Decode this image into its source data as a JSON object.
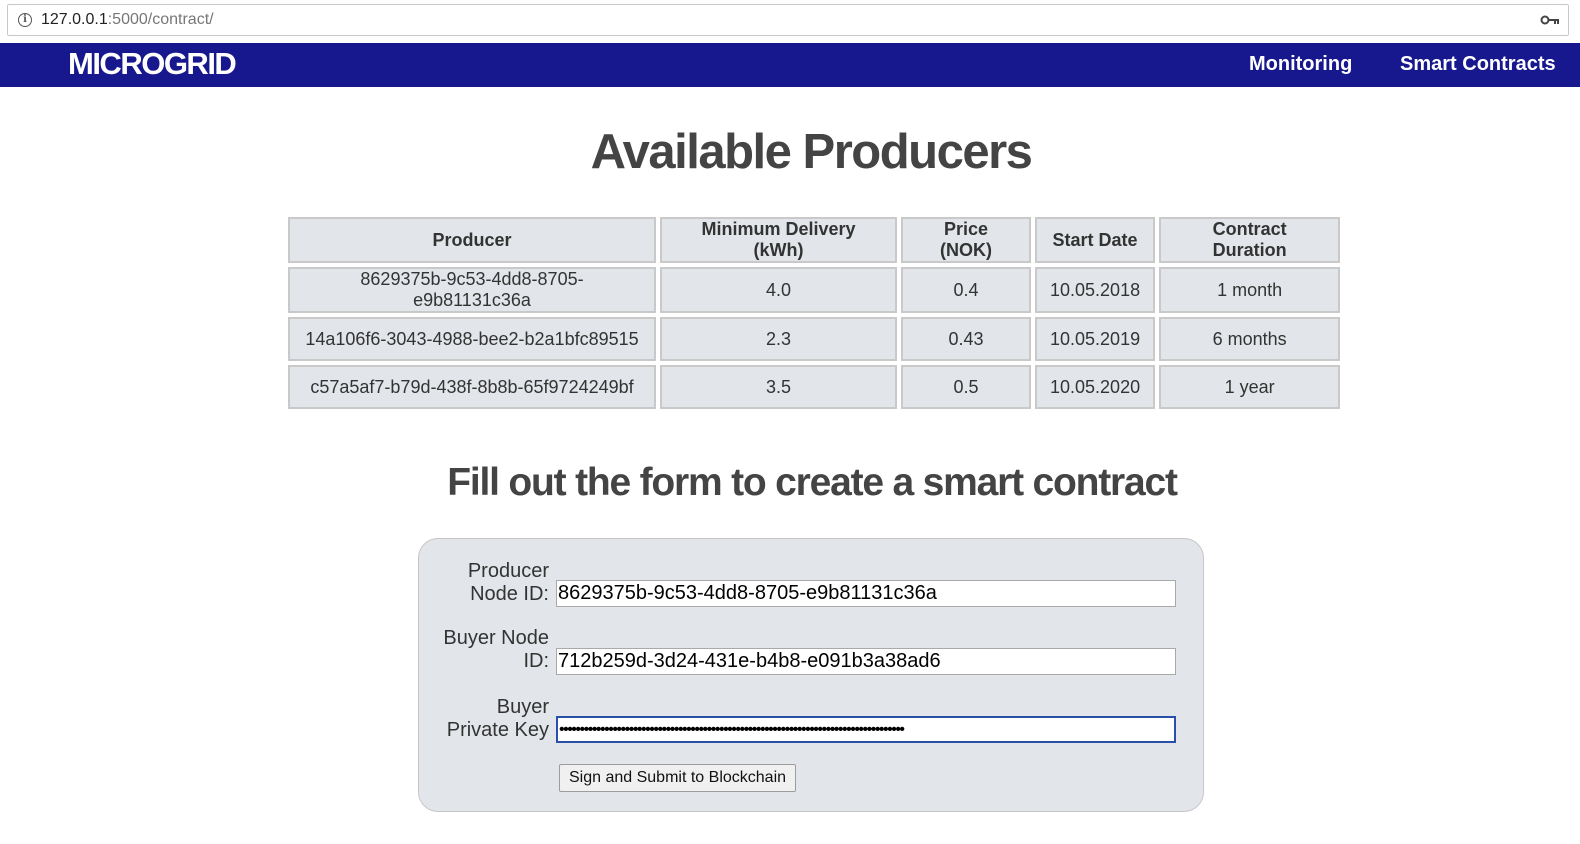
{
  "browser": {
    "url_host": "127.0.0.1",
    "url_path": ":5000/contract/"
  },
  "navbar": {
    "brand": "MICROGRID",
    "links": [
      "Monitoring",
      "Smart Contracts"
    ]
  },
  "page": {
    "title": "Available Producers",
    "form_heading": "Fill out the form to create a smart contract"
  },
  "table": {
    "headers": [
      "Producer",
      "Minimum Delivery (kWh)",
      "Price (NOK)",
      "Start Date",
      "Contract Duration"
    ],
    "rows": [
      [
        "8629375b-9c53-4dd8-8705-e9b81131c36a",
        "4.0",
        "0.4",
        "10.05.2018",
        "1 month"
      ],
      [
        "14a106f6-3043-4988-bee2-b2a1bfc89515",
        "2.3",
        "0.43",
        "10.05.2019",
        "6 months"
      ],
      [
        "c57a5af7-b79d-438f-8b8b-65f9724249bf",
        "3.5",
        "0.5",
        "10.05.2020",
        "1 year"
      ]
    ]
  },
  "form": {
    "producer_label_1": "Producer",
    "producer_label_2": "Node ID:",
    "producer_value": "8629375b-9c53-4dd8-8705-e9b81131c36a",
    "buyer_label_1": "Buyer Node",
    "buyer_label_2": "ID:",
    "buyer_value": "712b259d-3d24-431e-b4b8-e091b3a38ad6",
    "key_label_1": "Buyer",
    "key_label_2": "Private Key",
    "key_value": "••••••••••••••••••••••••••••••••••••••••••••••••••••••••••••••••••••••••••••••••••••",
    "submit_label": "Sign and Submit to Blockchain"
  }
}
